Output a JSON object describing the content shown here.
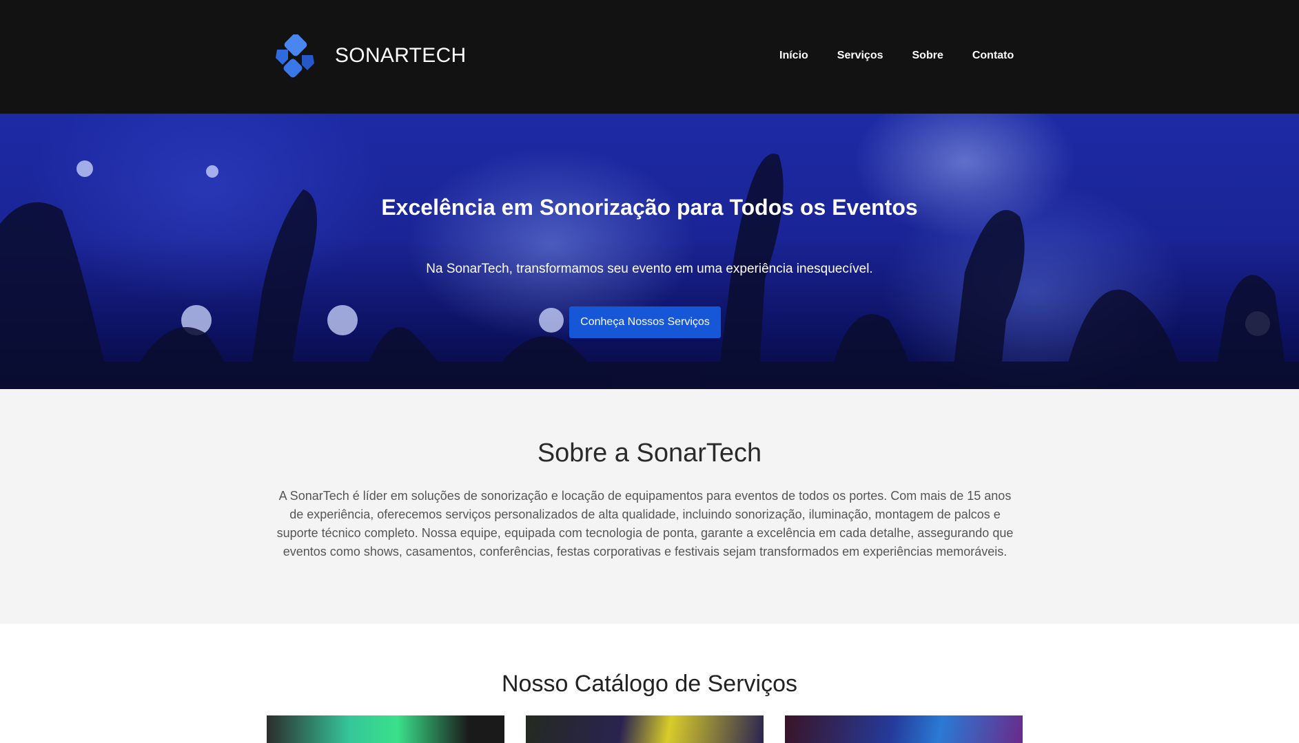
{
  "header": {
    "brand": "SONARTECH",
    "logo_icon": "sonartech-logo-icon",
    "nav": [
      "Início",
      "Serviços",
      "Sobre",
      "Contato"
    ]
  },
  "hero": {
    "title": "Excelência em Sonorização para Todos os Eventos",
    "subtitle": "Na SonarTech, transformamos seu evento em uma experiência inesquecível.",
    "cta": "Conheça Nossos Serviços"
  },
  "about": {
    "title": "Sobre a SonarTech",
    "text": "A SonarTech é líder em soluções de sonorização e locação de equipamentos para eventos de todos os portes. Com mais de 15 anos de experiência, oferecemos serviços personalizados de alta qualidade, incluindo sonorização, iluminação, montagem de palcos e suporte técnico completo. Nossa equipe, equipada com tecnologia de ponta, garante a excelência em cada detalhe, assegurando que eventos como shows, casamentos, conferências, festas corporativas e festivais sejam transformados em experiências memoráveis."
  },
  "services": {
    "title": "Nosso Catálogo de Serviços"
  },
  "colors": {
    "header_bg": "#121212",
    "accent": "#1557d6",
    "logo_blue": "#2f6be0",
    "about_bg": "#f4f4f4"
  }
}
